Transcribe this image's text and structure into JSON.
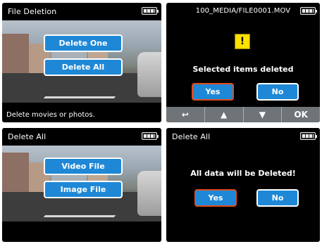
{
  "panel1": {
    "title": "File Deletion",
    "buttons": [
      "Delete One",
      "Delete All"
    ],
    "footer": "Delete movies or photos."
  },
  "panel2": {
    "title": "100_MEDIA/FILE0001.MOV",
    "warning_glyph": "!",
    "message": "Selected items deleted",
    "yes": "Yes",
    "no": "No",
    "nav": [
      "↩",
      "▲",
      "▼",
      "OK"
    ]
  },
  "panel3": {
    "title": "Delete All",
    "buttons": [
      "Video File",
      "Image File"
    ]
  },
  "panel4": {
    "title": "Delete All",
    "message": "All data will be Deleted!",
    "yes": "Yes",
    "no": "No"
  },
  "colors": {
    "button_blue": "#1e88d6",
    "selected_border": "#e24b1a",
    "warning_yellow": "#ffe000"
  }
}
